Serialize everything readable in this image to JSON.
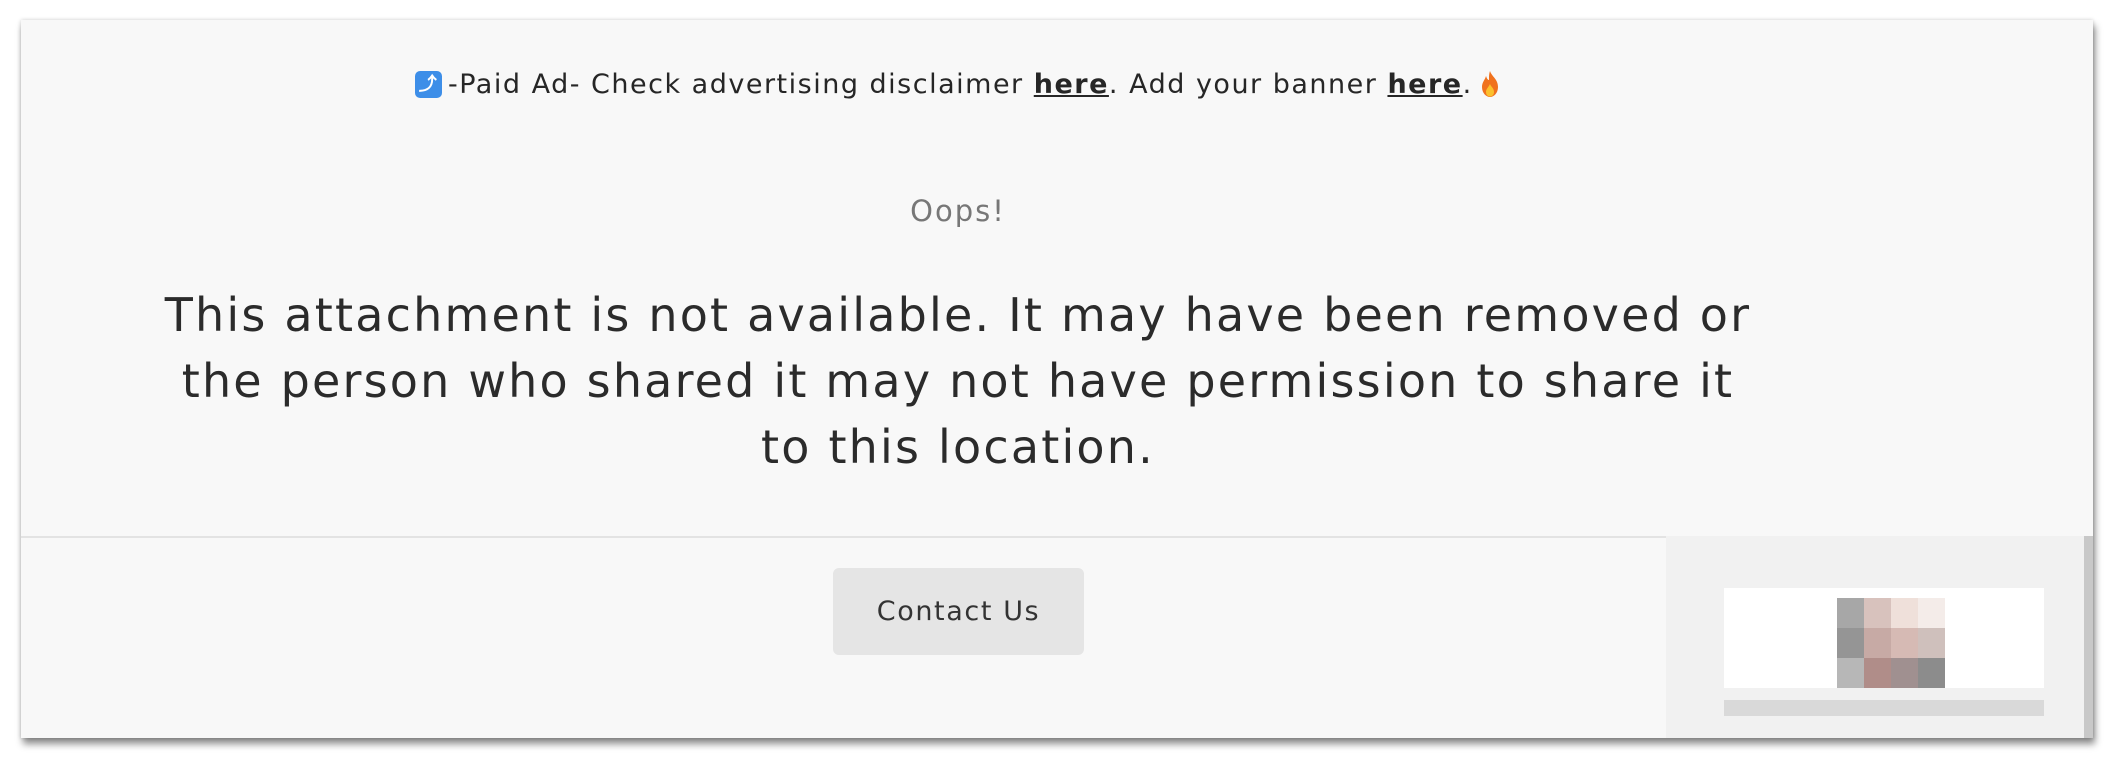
{
  "ad_banner": {
    "icon": "arrow-up-right-icon",
    "prefix": "-Paid Ad- Check advertising disclaimer ",
    "link1": "here",
    "middle": ". Add your banner ",
    "link2": "here",
    "suffix": ".",
    "trailing_icon": "fire-icon",
    "accent_color": "#3d8ee8"
  },
  "error": {
    "heading": "Oops!",
    "message": "This attachment is not available. It may have been removed or the person who shared it may not have permission to share it to this location."
  },
  "footer": {
    "contact_label": "Contact Us"
  },
  "chat_widget": {
    "avatar_icon": "user-avatar-icon"
  }
}
